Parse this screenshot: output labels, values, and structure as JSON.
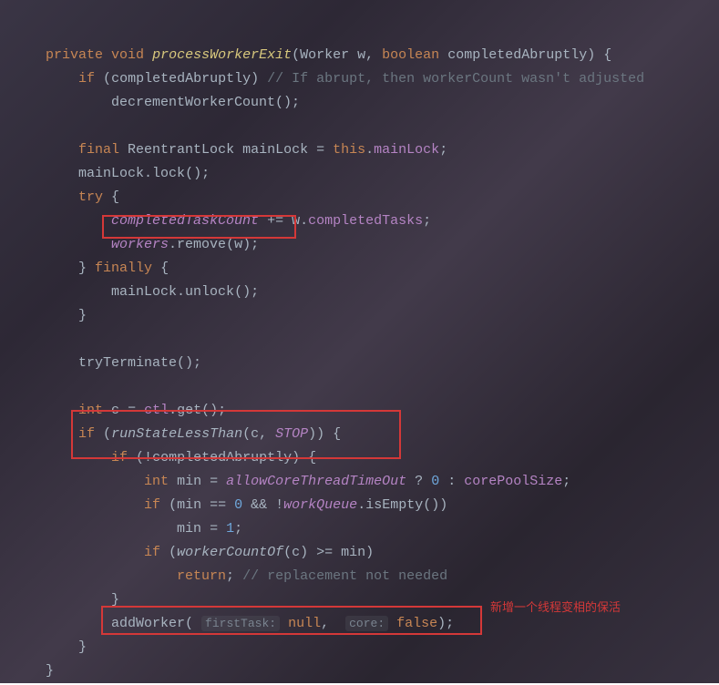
{
  "code": {
    "l1": {
      "private": "private",
      "void": "void",
      "method": "processWorkerExit",
      "type1": "Worker",
      "param1": "w",
      "boolean": "boolean",
      "param2": "completedAbruptly"
    },
    "l2": {
      "if": "if",
      "cond": "completedAbruptly",
      "comment": "// If abrupt, then workerCount wasn't adjusted"
    },
    "l3": {
      "call": "decrementWorkerCount"
    },
    "l4": {
      "final": "final",
      "type": "ReentrantLock",
      "var": "mainLock",
      "this": "this",
      "field": "mainLock"
    },
    "l5": {
      "var": "mainLock",
      "call": "lock"
    },
    "l6": {
      "try": "try"
    },
    "l7": {
      "field": "completedTaskCount",
      "op": "+=",
      "var": "w",
      "prop": "completedTasks"
    },
    "l8": {
      "field": "workers",
      "call": "remove",
      "arg": "w"
    },
    "l9": {
      "finally": "finally"
    },
    "l10": {
      "var": "mainLock",
      "call": "unlock"
    },
    "l11": {
      "call": "tryTerminate"
    },
    "l12": {
      "int": "int",
      "var": "c",
      "field": "ctl",
      "call": "get"
    },
    "l13": {
      "if": "if",
      "call": "runStateLessThan",
      "arg1": "c",
      "arg2": "STOP"
    },
    "l14": {
      "if": "if",
      "cond": "completedAbruptly"
    },
    "l15": {
      "int": "int",
      "var": "min",
      "field": "allowCoreThreadTimeOut",
      "zero": "0",
      "field2": "corePoolSize"
    },
    "l16": {
      "if": "if",
      "var": "min",
      "zero": "0",
      "field": "workQueue",
      "call": "isEmpty"
    },
    "l17": {
      "var": "min",
      "one": "1"
    },
    "l18": {
      "if": "if",
      "call": "workerCountOf",
      "arg": "c",
      "var": "min"
    },
    "l19": {
      "return": "return",
      "comment": "// replacement not needed"
    },
    "l20": {
      "call": "addWorker",
      "hint1": "firstTask:",
      "null": "null",
      "hint2": "core:",
      "false": "false"
    }
  },
  "annotation": "新增一个线程变相的保活"
}
